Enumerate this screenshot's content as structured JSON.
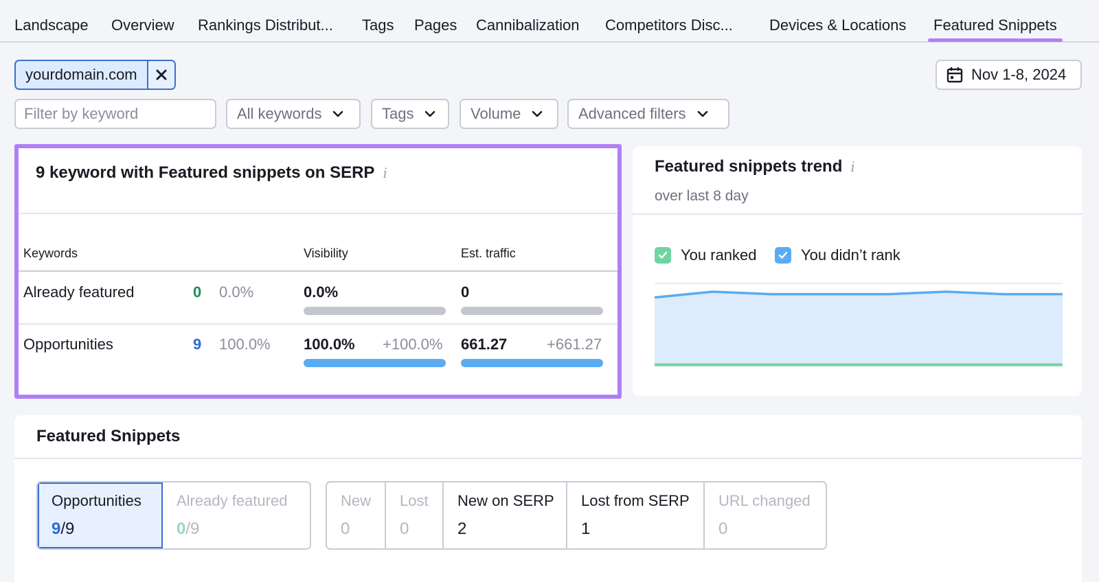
{
  "tabs": [
    {
      "label": "Landscape",
      "active": false
    },
    {
      "label": "Overview",
      "active": false
    },
    {
      "label": "Rankings Distribut...",
      "active": false
    },
    {
      "label": "Tags",
      "active": false
    },
    {
      "label": "Pages",
      "active": false
    },
    {
      "label": "Cannibalization",
      "active": false
    },
    {
      "label": "Competitors Disc...",
      "active": false
    },
    {
      "label": "Devices & Locations",
      "active": false
    },
    {
      "label": "Featured Snippets",
      "active": true
    }
  ],
  "domain_chip": {
    "label": "yourdomain.com"
  },
  "date_range": {
    "label": "Nov 1-8, 2024"
  },
  "filters": {
    "search_placeholder": "Filter by keyword",
    "all_keywords": "All keywords",
    "tags": "Tags",
    "volume": "Volume",
    "advanced": "Advanced filters"
  },
  "summary": {
    "title": "9 keyword with Featured snippets on SERP",
    "headers": {
      "keywords": "Keywords",
      "visibility": "Visibility",
      "traffic": "Est. traffic"
    },
    "rows": {
      "featured": {
        "label": "Already featured",
        "count": "0",
        "pct": "0.0%",
        "visibility": "0.0%",
        "visibility_fill": 0,
        "traffic": "0",
        "traffic_fill": 0
      },
      "opportunities": {
        "label": "Opportunities",
        "count": "9",
        "pct": "100.0%",
        "visibility": "100.0%",
        "visibility_delta": "+100.0%",
        "visibility_fill": 1,
        "traffic": "661.27",
        "traffic_delta": "+661.27",
        "traffic_fill": 1
      }
    }
  },
  "trend": {
    "title": "Featured snippets trend",
    "subtitle": "over last 8 day",
    "legend": {
      "ranked": "You ranked",
      "not_ranked": "You didn’t rank"
    },
    "colors": {
      "ranked": "#6fd3a2",
      "not_ranked": "#5aabf2"
    }
  },
  "chart_data": {
    "type": "area",
    "x": [
      1,
      2,
      3,
      4,
      5,
      6,
      7,
      8
    ],
    "series": [
      {
        "name": "You ranked",
        "values": [
          0,
          0,
          0,
          0,
          0,
          0,
          0,
          0
        ]
      },
      {
        "name": "You didn’t rank",
        "values": [
          8.3,
          9,
          8.7,
          8.7,
          8.7,
          9,
          8.7,
          8.7
        ]
      }
    ],
    "ylim": [
      0,
      10
    ],
    "grid": true
  },
  "snippets": {
    "title": "Featured Snippets",
    "segments_a": [
      {
        "label": "Opportunities",
        "value": "9",
        "total": "/9",
        "selected": true
      },
      {
        "label": "Already featured",
        "value": "0",
        "total": "/9",
        "selected": false
      }
    ],
    "segments_b": [
      {
        "label": "New",
        "value": "0",
        "disabled": true
      },
      {
        "label": "Lost",
        "value": "0",
        "disabled": true
      },
      {
        "label": "New on SERP",
        "value": "2",
        "disabled": false
      },
      {
        "label": "Lost from SERP",
        "value": "1",
        "disabled": false
      },
      {
        "label": "URL changed",
        "value": "0",
        "disabled": true
      }
    ]
  }
}
